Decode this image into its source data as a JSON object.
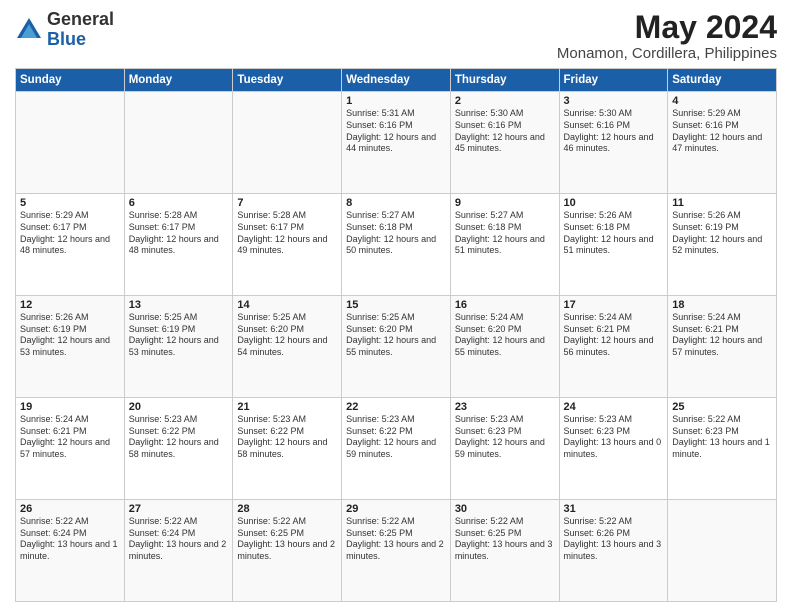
{
  "logo": {
    "general": "General",
    "blue": "Blue"
  },
  "title": "May 2024",
  "subtitle": "Monamon, Cordillera, Philippines",
  "weekdays": [
    "Sunday",
    "Monday",
    "Tuesday",
    "Wednesday",
    "Thursday",
    "Friday",
    "Saturday"
  ],
  "weeks": [
    [
      {
        "day": "",
        "info": ""
      },
      {
        "day": "",
        "info": ""
      },
      {
        "day": "",
        "info": ""
      },
      {
        "day": "1",
        "info": "Sunrise: 5:31 AM\nSunset: 6:16 PM\nDaylight: 12 hours\nand 44 minutes."
      },
      {
        "day": "2",
        "info": "Sunrise: 5:30 AM\nSunset: 6:16 PM\nDaylight: 12 hours\nand 45 minutes."
      },
      {
        "day": "3",
        "info": "Sunrise: 5:30 AM\nSunset: 6:16 PM\nDaylight: 12 hours\nand 46 minutes."
      },
      {
        "day": "4",
        "info": "Sunrise: 5:29 AM\nSunset: 6:16 PM\nDaylight: 12 hours\nand 47 minutes."
      }
    ],
    [
      {
        "day": "5",
        "info": "Sunrise: 5:29 AM\nSunset: 6:17 PM\nDaylight: 12 hours\nand 48 minutes."
      },
      {
        "day": "6",
        "info": "Sunrise: 5:28 AM\nSunset: 6:17 PM\nDaylight: 12 hours\nand 48 minutes."
      },
      {
        "day": "7",
        "info": "Sunrise: 5:28 AM\nSunset: 6:17 PM\nDaylight: 12 hours\nand 49 minutes."
      },
      {
        "day": "8",
        "info": "Sunrise: 5:27 AM\nSunset: 6:18 PM\nDaylight: 12 hours\nand 50 minutes."
      },
      {
        "day": "9",
        "info": "Sunrise: 5:27 AM\nSunset: 6:18 PM\nDaylight: 12 hours\nand 51 minutes."
      },
      {
        "day": "10",
        "info": "Sunrise: 5:26 AM\nSunset: 6:18 PM\nDaylight: 12 hours\nand 51 minutes."
      },
      {
        "day": "11",
        "info": "Sunrise: 5:26 AM\nSunset: 6:19 PM\nDaylight: 12 hours\nand 52 minutes."
      }
    ],
    [
      {
        "day": "12",
        "info": "Sunrise: 5:26 AM\nSunset: 6:19 PM\nDaylight: 12 hours\nand 53 minutes."
      },
      {
        "day": "13",
        "info": "Sunrise: 5:25 AM\nSunset: 6:19 PM\nDaylight: 12 hours\nand 53 minutes."
      },
      {
        "day": "14",
        "info": "Sunrise: 5:25 AM\nSunset: 6:20 PM\nDaylight: 12 hours\nand 54 minutes."
      },
      {
        "day": "15",
        "info": "Sunrise: 5:25 AM\nSunset: 6:20 PM\nDaylight: 12 hours\nand 55 minutes."
      },
      {
        "day": "16",
        "info": "Sunrise: 5:24 AM\nSunset: 6:20 PM\nDaylight: 12 hours\nand 55 minutes."
      },
      {
        "day": "17",
        "info": "Sunrise: 5:24 AM\nSunset: 6:21 PM\nDaylight: 12 hours\nand 56 minutes."
      },
      {
        "day": "18",
        "info": "Sunrise: 5:24 AM\nSunset: 6:21 PM\nDaylight: 12 hours\nand 57 minutes."
      }
    ],
    [
      {
        "day": "19",
        "info": "Sunrise: 5:24 AM\nSunset: 6:21 PM\nDaylight: 12 hours\nand 57 minutes."
      },
      {
        "day": "20",
        "info": "Sunrise: 5:23 AM\nSunset: 6:22 PM\nDaylight: 12 hours\nand 58 minutes."
      },
      {
        "day": "21",
        "info": "Sunrise: 5:23 AM\nSunset: 6:22 PM\nDaylight: 12 hours\nand 58 minutes."
      },
      {
        "day": "22",
        "info": "Sunrise: 5:23 AM\nSunset: 6:22 PM\nDaylight: 12 hours\nand 59 minutes."
      },
      {
        "day": "23",
        "info": "Sunrise: 5:23 AM\nSunset: 6:23 PM\nDaylight: 12 hours\nand 59 minutes."
      },
      {
        "day": "24",
        "info": "Sunrise: 5:23 AM\nSunset: 6:23 PM\nDaylight: 13 hours\nand 0 minutes."
      },
      {
        "day": "25",
        "info": "Sunrise: 5:22 AM\nSunset: 6:23 PM\nDaylight: 13 hours\nand 1 minute."
      }
    ],
    [
      {
        "day": "26",
        "info": "Sunrise: 5:22 AM\nSunset: 6:24 PM\nDaylight: 13 hours\nand 1 minute."
      },
      {
        "day": "27",
        "info": "Sunrise: 5:22 AM\nSunset: 6:24 PM\nDaylight: 13 hours\nand 2 minutes."
      },
      {
        "day": "28",
        "info": "Sunrise: 5:22 AM\nSunset: 6:25 PM\nDaylight: 13 hours\nand 2 minutes."
      },
      {
        "day": "29",
        "info": "Sunrise: 5:22 AM\nSunset: 6:25 PM\nDaylight: 13 hours\nand 2 minutes."
      },
      {
        "day": "30",
        "info": "Sunrise: 5:22 AM\nSunset: 6:25 PM\nDaylight: 13 hours\nand 3 minutes."
      },
      {
        "day": "31",
        "info": "Sunrise: 5:22 AM\nSunset: 6:26 PM\nDaylight: 13 hours\nand 3 minutes."
      },
      {
        "day": "",
        "info": ""
      }
    ]
  ]
}
